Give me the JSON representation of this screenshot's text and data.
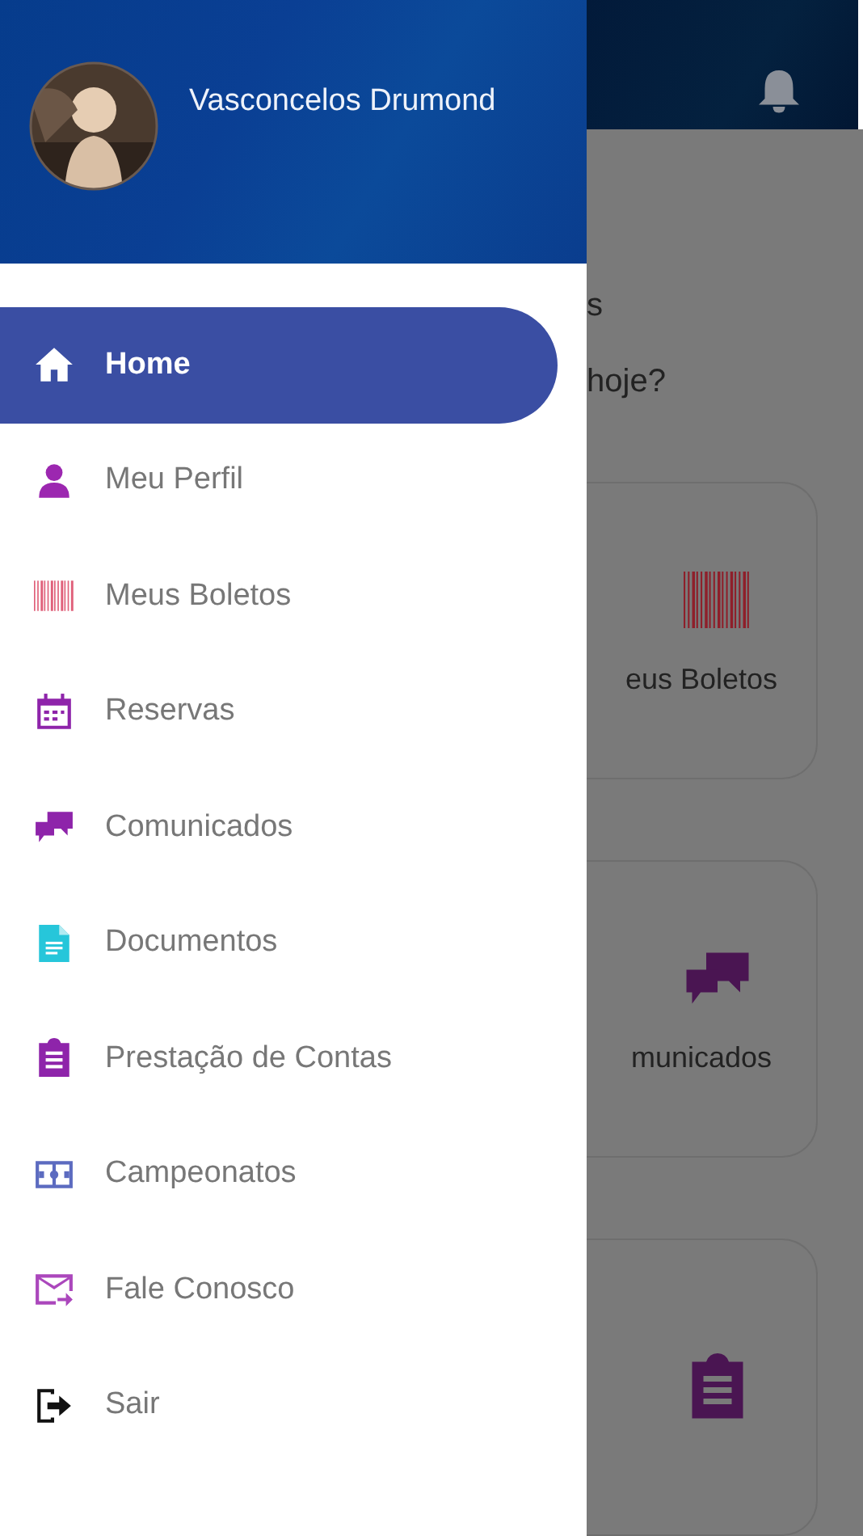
{
  "drawer": {
    "user_name": "Vasconcelos Drumond",
    "items": [
      {
        "label": "Home",
        "kind": "home",
        "color": "#ffffff",
        "selected": true
      },
      {
        "label": "Meu Perfil",
        "kind": "person",
        "color": "#9c27b0",
        "selected": false
      },
      {
        "label": "Meus Boletos",
        "kind": "barcode",
        "color": "#e0607a",
        "selected": false
      },
      {
        "label": "Reservas",
        "kind": "calendar",
        "color": "#8e24aa",
        "selected": false
      },
      {
        "label": "Comunicados",
        "kind": "chat",
        "color": "#8e24aa",
        "selected": false
      },
      {
        "label": "Documentos",
        "kind": "document",
        "color": "#26c6da",
        "selected": false
      },
      {
        "label": "Prestação de Contas",
        "kind": "clipboard",
        "color": "#8e24aa",
        "selected": false
      },
      {
        "label": "Campeonatos",
        "kind": "field",
        "color": "#5c6bc0",
        "selected": false
      },
      {
        "label": "Fale Conosco",
        "kind": "mail",
        "color": "#ab47bc",
        "selected": false
      },
      {
        "label": "Sair",
        "kind": "logout",
        "color": "#111111",
        "selected": false
      }
    ]
  },
  "background_page": {
    "heading": "s",
    "subtitle": "hoje?",
    "cards": [
      {
        "label": "eus Boletos",
        "kind": "barcode",
        "color": "#8e1f2a"
      },
      {
        "label": "municados",
        "kind": "chat",
        "color": "#4a1552"
      },
      {
        "kind": "clipboard",
        "color": "#4a1552"
      }
    ]
  }
}
